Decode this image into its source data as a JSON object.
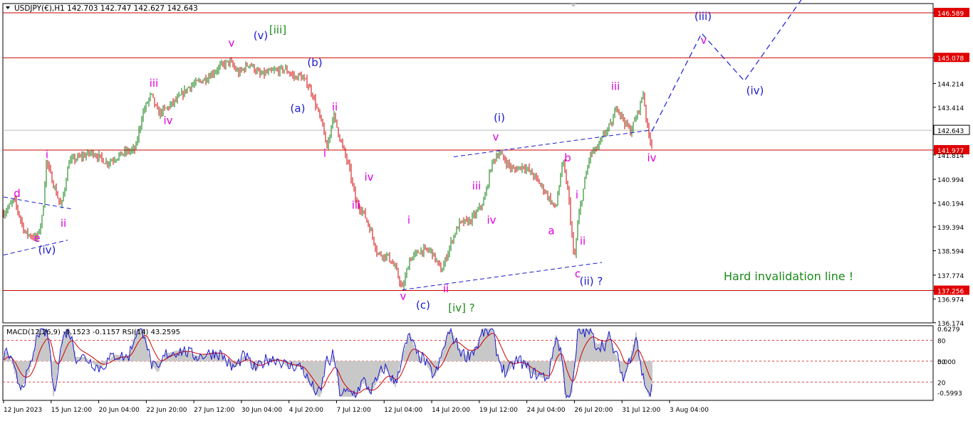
{
  "chart_data": [
    {
      "type": "candlestick",
      "title": "USDJPY(€),H1  142.703 142.747 142.627 142.643",
      "symbol": "USDJPY(€),H1",
      "ohlc": {
        "open": 142.703,
        "high": 142.747,
        "low": 142.627,
        "close": 142.643
      },
      "up_color": "#0a7a0a",
      "down_color": "#d00000",
      "ylim": [
        136.17,
        146.9
      ],
      "y_ticks": [
        "146.589",
        "145.078",
        "144.214",
        "143.414",
        "142.643",
        "141.977",
        "141.814",
        "140.994",
        "140.194",
        "139.394",
        "138.594",
        "137.774",
        "137.256",
        "136.974",
        "136.174"
      ],
      "x_ticks": [
        "12 Jun 2023",
        "15 Jun 12:00",
        "20 Jun 04:00",
        "22 Jun 20:00",
        "27 Jun 12:00",
        "30 Jun 04:00",
        "4 Jul 20:00",
        "7 Jul 12:00",
        "12 Jul 04:00",
        "14 Jul 20:00",
        "19 Jul 12:00",
        "24 Jul 04:00",
        "26 Jul 20:00",
        "31 Jul 12:00",
        "3 Aug 04:00"
      ],
      "horizontal_levels": [
        {
          "value": 146.589,
          "label": "146.589",
          "color": "#cc0000"
        },
        {
          "value": 145.078,
          "label": "145.078",
          "color": "#cc0000"
        },
        {
          "value": 141.977,
          "label": "141.977",
          "color": "#cc0000"
        },
        {
          "value": 137.256,
          "label": "137.256",
          "color": "#cc0000"
        }
      ],
      "current_price": {
        "value": 142.643,
        "label": "142.643"
      },
      "price_path": [
        [
          0,
          139.7
        ],
        [
          20,
          140.3
        ],
        [
          35,
          139.2
        ],
        [
          52,
          139.0
        ],
        [
          60,
          139.8
        ],
        [
          65,
          141.6
        ],
        [
          78,
          140.6
        ],
        [
          86,
          140.05
        ],
        [
          97,
          141.6
        ],
        [
          130,
          141.9
        ],
        [
          150,
          141.55
        ],
        [
          175,
          141.9
        ],
        [
          190,
          142.0
        ],
        [
          200,
          143.2
        ],
        [
          212,
          143.85
        ],
        [
          222,
          143.2
        ],
        [
          235,
          143.4
        ],
        [
          250,
          143.7
        ],
        [
          265,
          144.1
        ],
        [
          290,
          144.4
        ],
        [
          310,
          144.8
        ],
        [
          322,
          144.95
        ],
        [
          335,
          144.55
        ],
        [
          350,
          144.9
        ],
        [
          365,
          144.5
        ],
        [
          380,
          144.6
        ],
        [
          400,
          144.7
        ],
        [
          415,
          144.4
        ],
        [
          420,
          144.5
        ],
        [
          432,
          144.2
        ],
        [
          438,
          143.9
        ],
        [
          455,
          142.6
        ],
        [
          458,
          141.9
        ],
        [
          468,
          143.2
        ],
        [
          478,
          142.3
        ],
        [
          490,
          141.4
        ],
        [
          500,
          140.2
        ],
        [
          510,
          139.9
        ],
        [
          520,
          139.3
        ],
        [
          530,
          138.5
        ],
        [
          545,
          138.4
        ],
        [
          555,
          138.0
        ],
        [
          565,
          137.3
        ],
        [
          575,
          138.3
        ],
        [
          590,
          138.6
        ],
        [
          605,
          138.6
        ],
        [
          620,
          137.9
        ],
        [
          635,
          139.0
        ],
        [
          645,
          139.5
        ],
        [
          660,
          139.6
        ],
        [
          670,
          139.9
        ],
        [
          680,
          140.3
        ],
        [
          690,
          141.5
        ],
        [
          700,
          141.9
        ],
        [
          710,
          141.6
        ],
        [
          720,
          141.3
        ],
        [
          735,
          141.45
        ],
        [
          750,
          141.1
        ],
        [
          765,
          140.6
        ],
        [
          780,
          140.0
        ],
        [
          790,
          141.6
        ],
        [
          798,
          140.5
        ],
        [
          806,
          138.2
        ],
        [
          812,
          139.7
        ],
        [
          820,
          140.8
        ],
        [
          828,
          141.8
        ],
        [
          840,
          142.1
        ],
        [
          850,
          142.6
        ],
        [
          860,
          142.9
        ],
        [
          865,
          143.5
        ],
        [
          875,
          143.0
        ],
        [
          885,
          142.6
        ],
        [
          895,
          143.2
        ],
        [
          903,
          143.9
        ],
        [
          910,
          142.5
        ],
        [
          915,
          142.2
        ]
      ],
      "labels": [
        {
          "text": "d",
          "value": 140.4,
          "x_pos": 24,
          "color": "#e000e0"
        },
        {
          "text": "e",
          "value": 138.9,
          "x_pos": 52,
          "color": "#e000e0"
        },
        {
          "text": "(iv)",
          "value": 138.5,
          "x_pos": 66,
          "color": "#1a1ad0"
        },
        {
          "text": "i",
          "value": 141.7,
          "x_pos": 66,
          "color": "#e000e0"
        },
        {
          "text": "ii",
          "value": 139.4,
          "x_pos": 89,
          "color": "#e000e0"
        },
        {
          "text": "iii",
          "value": 144.1,
          "x_pos": 216,
          "color": "#e000e0"
        },
        {
          "text": "iv",
          "value": 142.85,
          "x_pos": 236,
          "color": "#e000e0"
        },
        {
          "text": "v",
          "value": 145.45,
          "x_pos": 325,
          "color": "#e000e0"
        },
        {
          "text": "(v)",
          "value": 145.7,
          "x_pos": 366,
          "color": "#1a1ad0"
        },
        {
          "text": "[iii]",
          "value": 145.9,
          "x_pos": 390,
          "color": "#1a8a1a"
        },
        {
          "text": "(b)",
          "value": 144.8,
          "x_pos": 442,
          "color": "#1a1ad0"
        },
        {
          "text": "(a)",
          "value": 143.25,
          "x_pos": 418,
          "color": "#1a1ad0"
        },
        {
          "text": "ii",
          "value": 143.3,
          "x_pos": 470,
          "color": "#e000e0"
        },
        {
          "text": "i",
          "value": 141.75,
          "x_pos": 456,
          "color": "#e000e0"
        },
        {
          "text": "iv",
          "value": 140.95,
          "x_pos": 518,
          "color": "#e000e0"
        },
        {
          "text": "iii",
          "value": 140.0,
          "x_pos": 500,
          "color": "#e000e0"
        },
        {
          "text": "i",
          "value": 139.5,
          "x_pos": 574,
          "color": "#e000e0"
        },
        {
          "text": "v",
          "value": 136.95,
          "x_pos": 566,
          "color": "#e000e0"
        },
        {
          "text": "ii",
          "value": 137.2,
          "x_pos": 626,
          "color": "#e000e0"
        },
        {
          "text": "(c)",
          "value": 136.65,
          "x_pos": 594,
          "color": "#1a1ad0"
        },
        {
          "text": "[iv] ?",
          "value": 136.55,
          "x_pos": 648,
          "color": "#1a8a1a"
        },
        {
          "text": "iii",
          "value": 140.65,
          "x_pos": 669,
          "color": "#e000e0"
        },
        {
          "text": "iv",
          "value": 139.5,
          "x_pos": 690,
          "color": "#e000e0"
        },
        {
          "text": "(i)",
          "value": 142.95,
          "x_pos": 701,
          "color": "#1a1ad0"
        },
        {
          "text": "v",
          "value": 142.3,
          "x_pos": 696,
          "color": "#e000e0"
        },
        {
          "text": "b",
          "value": 141.6,
          "x_pos": 797,
          "color": "#e000e0"
        },
        {
          "text": "a",
          "value": 139.15,
          "x_pos": 774,
          "color": "#e000e0"
        },
        {
          "text": "i",
          "value": 140.35,
          "x_pos": 810,
          "color": "#e000e0"
        },
        {
          "text": "ii",
          "value": 138.8,
          "x_pos": 818,
          "color": "#e000e0"
        },
        {
          "text": "c",
          "value": 137.7,
          "x_pos": 811,
          "color": "#e000e0"
        },
        {
          "text": "(ii) ?",
          "value": 137.45,
          "x_pos": 830,
          "color": "#1a1ad0"
        },
        {
          "text": "iii",
          "value": 144.0,
          "x_pos": 864,
          "color": "#e000e0"
        },
        {
          "text": "iv",
          "value": 141.6,
          "x_pos": 915,
          "color": "#e000e0"
        },
        {
          "text": "(iii)",
          "value": 146.35,
          "x_pos": 987,
          "color": "#1a1ad0"
        },
        {
          "text": "v",
          "value": 145.55,
          "x_pos": 988,
          "color": "#e000e0"
        },
        {
          "text": "(iv)",
          "value": 143.85,
          "x_pos": 1060,
          "color": "#1a1ad0"
        },
        {
          "text": "Hard invalidation line !",
          "value": 137.6,
          "x_pos": 1016,
          "color": "#1a8a1a"
        }
      ],
      "trendlines": [
        {
          "points": [
            [
              5,
              140.4
            ],
            [
              100,
              140.0
            ]
          ],
          "color": "#1a1ad0"
        },
        {
          "points": [
            [
              5,
              138.45
            ],
            [
              95,
              138.95
            ]
          ],
          "color": "#1a1ad0"
        },
        {
          "points": [
            [
              565,
              137.28
            ],
            [
              845,
              138.2
            ]
          ],
          "color": "#1a1ad0"
        },
        {
          "points": [
            [
              637,
              141.75
            ],
            [
              915,
              142.65
            ]
          ],
          "color": "#1a1ad0"
        }
      ],
      "projection": {
        "points": [
          [
            915,
            142.6
          ],
          [
            985,
            145.9
          ],
          [
            1045,
            144.3
          ],
          [
            1130,
            147.2
          ]
        ],
        "color": "#1a1ad0"
      }
    },
    {
      "type": "oscillator",
      "title": "MACD(12,26,9) -0.1523 -0.1157 RSI(14) 43.2595",
      "macd": {
        "main": -0.1523,
        "signal": -0.1157
      },
      "rsi": 43.2595,
      "y_ticks_left": [
        "0.6279",
        "0.000",
        "-0.5993"
      ],
      "y_ticks_right": [
        "80",
        "50",
        "20"
      ],
      "ylim": [
        -0.75,
        0.68
      ],
      "levels": [
        0.4,
        0.0,
        -0.4
      ]
    }
  ]
}
